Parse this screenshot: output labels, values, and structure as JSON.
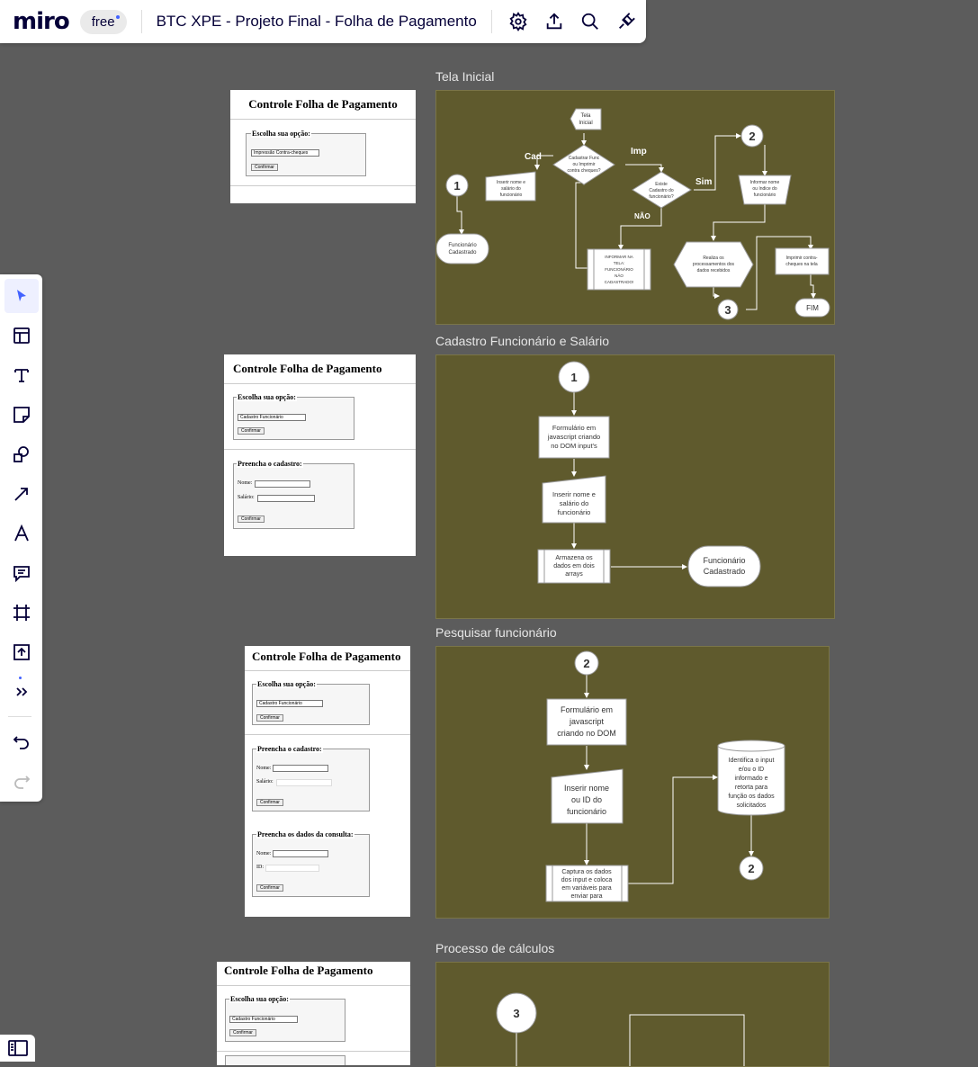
{
  "app": {
    "logo": "miro",
    "plan": "free",
    "board_title": "BTC XPE - Projeto Final - Folha de Pagamento",
    "actions": [
      {
        "name": "settings-icon"
      },
      {
        "name": "share-upload-icon"
      },
      {
        "name": "search-icon"
      },
      {
        "name": "integrations-icon"
      }
    ],
    "colors": {
      "canvas": "#5c5c5c",
      "frame": "#5f5a2d",
      "accent": "#4262ff",
      "brand": "#050038"
    }
  },
  "toolbar": {
    "tools": [
      "select-tool",
      "templates-tool",
      "text-tool",
      "sticky-note-tool",
      "shapes-tool",
      "connection-line-tool",
      "pen-tool",
      "comment-tool",
      "frame-tool",
      "upload-tool",
      "more-tools",
      "undo",
      "redo"
    ]
  },
  "frames": {
    "f1": {
      "title": "Tela Inicial"
    },
    "f2": {
      "title": "Cadastro Funcionário e Salário"
    },
    "f3": {
      "title": "Pesquisar funcionário"
    },
    "f4": {
      "title": "Processo de cálculos"
    }
  },
  "flow1": {
    "start": [
      "Tela",
      "Inicial"
    ],
    "decision": [
      "Cadastrar  Func",
      "ou Imprimir",
      "contra cheques?"
    ],
    "cad": "Cad",
    "imp": "Imp",
    "n1": "1",
    "input": [
      "Inserir nome e",
      "salário do",
      "funcionário"
    ],
    "registered": [
      "Funcionário",
      "Cadastrado"
    ],
    "exists": [
      "Existe",
      "Cadastro do",
      "funcionário?"
    ],
    "sim": "Sim",
    "nao": "NÃO",
    "n2": "2",
    "inform": [
      "Informar nome",
      "ou índice do",
      "funcionário"
    ],
    "notfound": [
      "INFORMAR NA",
      "TELA:",
      "FUNCIONÁRIO",
      "NÃO",
      "CADASTRADO!"
    ],
    "process": [
      "Realiza os",
      "processamentos dos",
      "dados recebidos"
    ],
    "n3": "3",
    "print": [
      "Imprimir contra-",
      "cheques na tela"
    ],
    "end": "FIM"
  },
  "flow2": {
    "n1": "1",
    "form": [
      "Formulário em",
      "javascript  criando",
      "no DOM input's"
    ],
    "input": [
      "Inserir nome e",
      "salário do",
      "funcionário"
    ],
    "store": [
      "Armazena os",
      "dados em dois",
      "arrays"
    ],
    "registered": [
      "Funcionário",
      "Cadastrado"
    ]
  },
  "flow3": {
    "n2": "2",
    "form": [
      "Formulário em",
      "javascript",
      "criando no DOM"
    ],
    "input": [
      "Inserir nome",
      "ou ID do",
      "funcionário"
    ],
    "capture": [
      "Captura os dados",
      "dos input e coloca",
      "em variáveis para",
      "enviar para"
    ],
    "db": [
      "Identifica o input",
      "e/ou o ID",
      "informado e",
      "retorta para",
      "função os dados",
      "solicitados"
    ],
    "n2b": "2"
  },
  "flow4": {
    "n3": "3"
  },
  "screens": {
    "title": "Controle Folha de Pagamento",
    "choose": "Escolha sua opção:",
    "confirm": "Confirmar",
    "option_print": "Impressão Contra-cheques",
    "option_cadastro": "Cadastro Funcionário",
    "fill": "Preencha o cadastro:",
    "nome": "Nome:",
    "salario": "Salário:",
    "query": "Preencha os dados da consulta:",
    "id": "ID:"
  }
}
